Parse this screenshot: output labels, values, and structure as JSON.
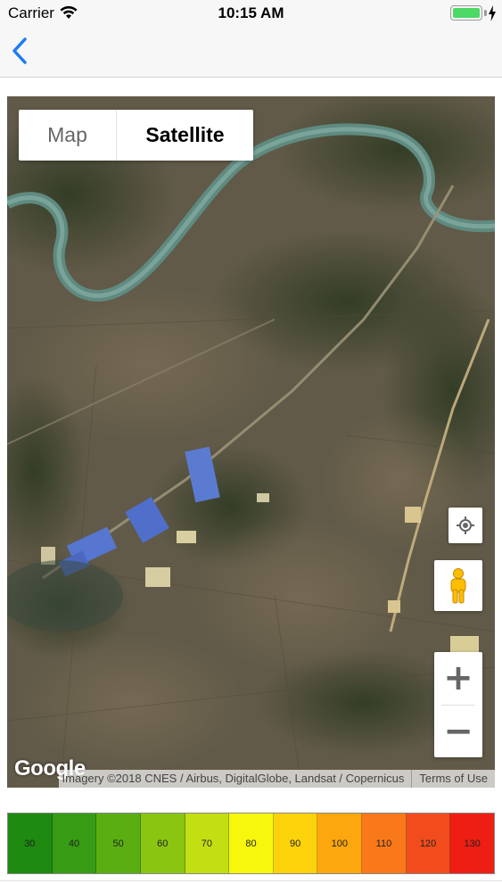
{
  "status_bar": {
    "carrier": "Carrier",
    "time": "10:15 AM"
  },
  "nav": {
    "back_icon": "chevron-left-icon"
  },
  "map": {
    "map_type_options": [
      "Map",
      "Satellite"
    ],
    "selected_map_type": "Satellite",
    "logo_text": "Google",
    "attribution": "Imagery ©2018 CNES / Airbus, DigitalGlobe, Landsat / Copernicus",
    "terms": "Terms of Use",
    "controls": {
      "locate_icon": "my-location-icon",
      "street_view_icon": "pegman-icon",
      "zoom_in": "+",
      "zoom_out": "−"
    }
  },
  "legend": {
    "values": [
      "30",
      "40",
      "50",
      "60",
      "70",
      "80",
      "90",
      "100",
      "110",
      "120",
      "130"
    ],
    "colors": [
      "#1e8a10",
      "#379c14",
      "#5aae12",
      "#8ac512",
      "#c2df12",
      "#f6f70c",
      "#fcd30a",
      "#fca70e",
      "#f8781a",
      "#f24c1c",
      "#ee1e14"
    ]
  }
}
